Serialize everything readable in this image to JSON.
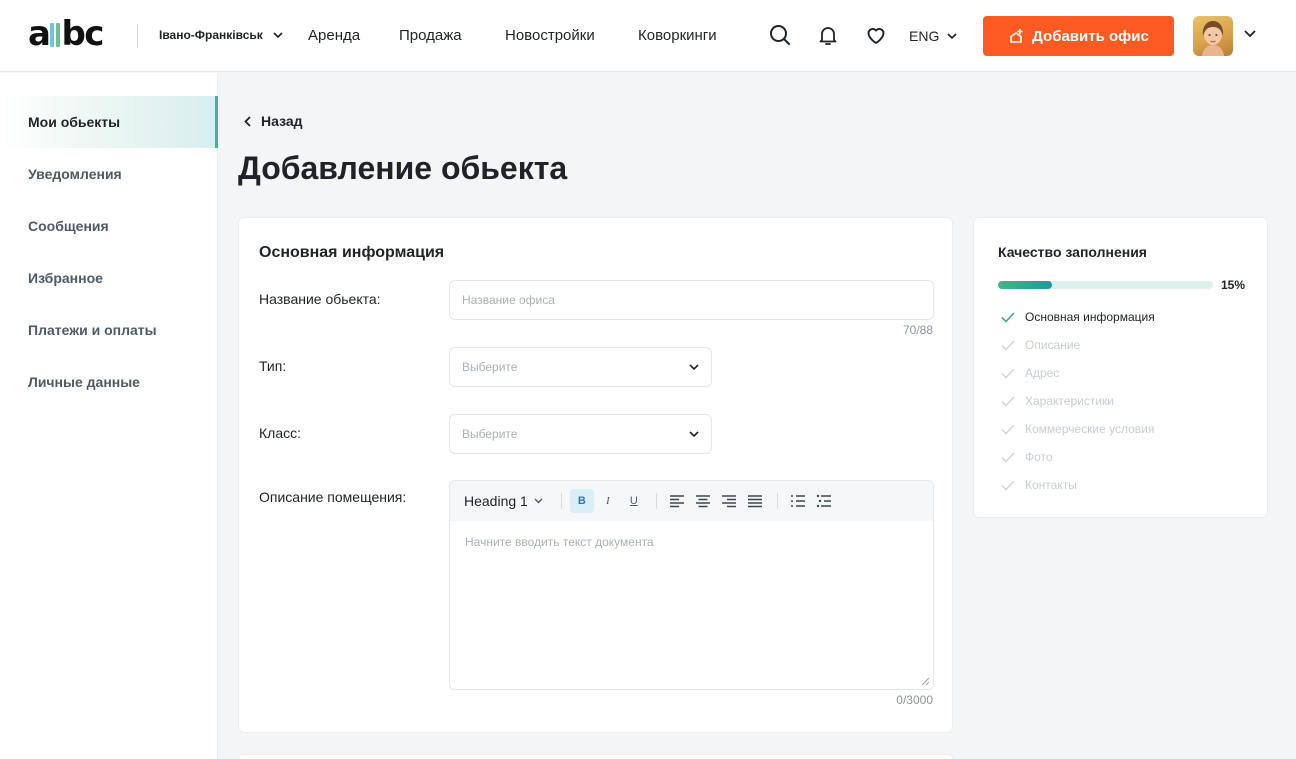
{
  "header": {
    "logo_a": "a",
    "logo_rest": "bc",
    "city": "Івано-Франківськ",
    "nav": [
      "Аренда",
      "Продажа",
      "Новостройки",
      "Коворкинги"
    ],
    "lang": "ENG",
    "add_office": "Добавить офис",
    "accent": "#fb5a23"
  },
  "sidebar": {
    "items": [
      {
        "label": "Мои обьекты",
        "active": true
      },
      {
        "label": "Уведомления"
      },
      {
        "label": "Сообщения"
      },
      {
        "label": "Избранное"
      },
      {
        "label": "Платежи и оплаты"
      },
      {
        "label": "Личные данные"
      }
    ]
  },
  "main": {
    "back": "Назад",
    "title": "Добавление обьекта",
    "section": "Основная информация",
    "name_label": "Название обьекта:",
    "name_placeholder": "Название офиса",
    "name_counter": "70/88",
    "type_label": "Тип:",
    "type_placeholder": "Выберите",
    "class_label": "Класс:",
    "class_placeholder": "Выберите",
    "desc_label": "Описание помещения:",
    "editor": {
      "heading": "Heading 1",
      "bold": "B",
      "italic": "I",
      "underline": "U",
      "placeholder": "Начните вводить текст документа",
      "counter": "0/3000"
    }
  },
  "quality": {
    "title": "Качество заполнения",
    "percent_label": "15%",
    "percent": 15,
    "items": [
      {
        "label": "Основная информация",
        "done": true
      },
      {
        "label": "Описание",
        "done": false
      },
      {
        "label": "Адрес",
        "done": false
      },
      {
        "label": "Характеристики",
        "done": false
      },
      {
        "label": "Коммерческие условия",
        "done": false
      },
      {
        "label": "Фото",
        "done": false
      },
      {
        "label": "Контакты",
        "done": false
      }
    ]
  }
}
